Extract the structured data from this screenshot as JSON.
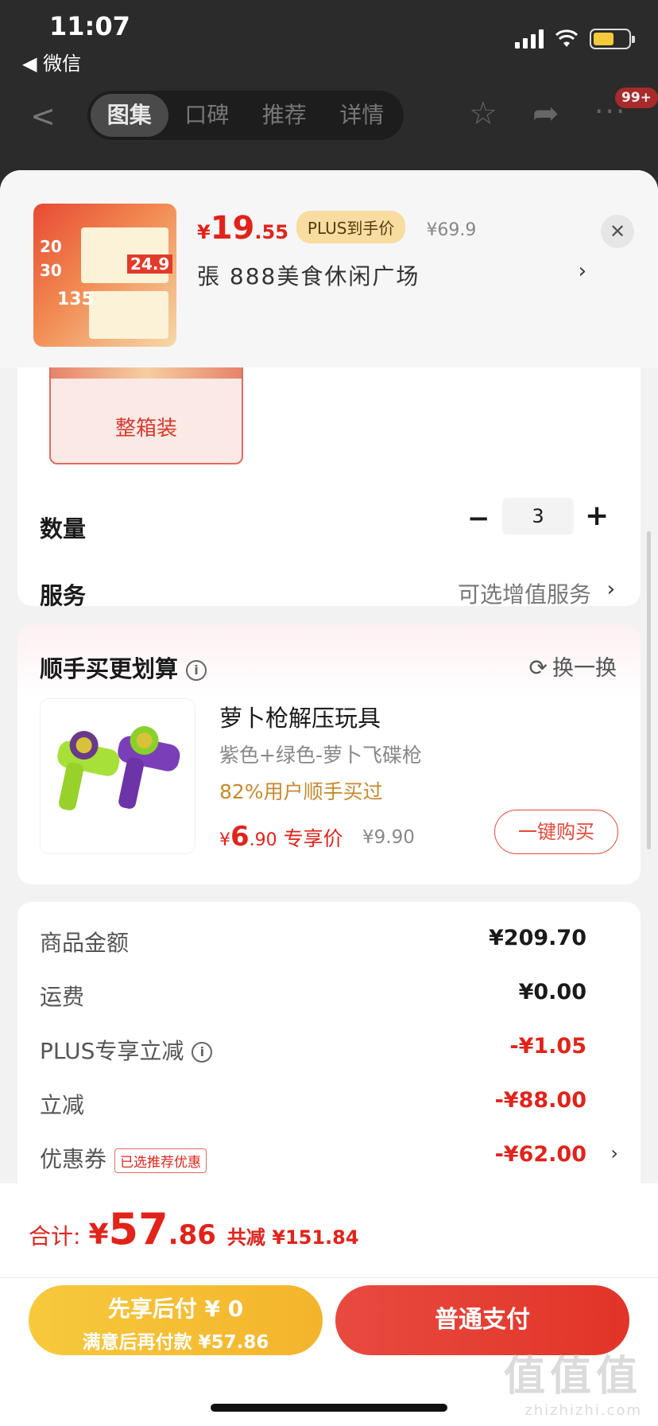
{
  "status": {
    "time": "11:07",
    "back_app": "◀ 微信"
  },
  "nav": {
    "back_icon": "chevron-left-icon",
    "tabs": [
      {
        "label": "图集",
        "active": true
      },
      {
        "label": "口碑",
        "active": false
      },
      {
        "label": "推荐",
        "active": false
      },
      {
        "label": "详情",
        "active": false
      }
    ],
    "badge": "99+"
  },
  "product": {
    "price_yen": "¥",
    "price_int": "19",
    "price_dec": ".55",
    "plus_tag": "PLUS到手价",
    "original_price": "¥69.9",
    "spec": "張  888美食休闲广场",
    "thumb_text": {
      "a": "20",
      "b": "30",
      "c": "135",
      "d": "24.9"
    }
  },
  "variant": {
    "label": "整箱装"
  },
  "quantity": {
    "label": "数量",
    "value": "3",
    "minus": "−",
    "plus": "+"
  },
  "service": {
    "label": "服务",
    "value": "可选增值服务"
  },
  "buy_together": {
    "title": "顺手买更划算",
    "refresh": "换一换",
    "name": "萝卜枪解压玩具",
    "spec": "紫色+绿色-萝卜飞碟枪",
    "hint": "82%用户顺手买过",
    "price_yen": "¥",
    "price_int": "6",
    "price_dec": ".90",
    "price_label": "专享价",
    "original_price": "¥9.90",
    "buy_label": "一键购买"
  },
  "amounts": {
    "rows": [
      {
        "label": "商品金额",
        "value": "¥209.70"
      },
      {
        "label": "运费",
        "value": "¥0.00"
      },
      {
        "label": "PLUS专享立减",
        "value": "-¥1.05"
      },
      {
        "label": "立减",
        "value": "-¥88.00"
      },
      {
        "label": "优惠券",
        "value": "-¥62.00",
        "tag": "已选推荐优惠"
      }
    ]
  },
  "total": {
    "label": "合计:",
    "yen": "¥",
    "int": "57",
    "dec": ".86",
    "saved": "共减 ¥151.84"
  },
  "buttons": {
    "later_line1": "先享后付 ¥ 0",
    "later_line2": "满意后再付款 ¥57.86",
    "pay": "普通支付"
  },
  "watermark": {
    "line1": "值值值",
    "line2": "zhizhizhi.com"
  },
  "colors": {
    "accent": "#e2231a",
    "gold": "#f7c93c",
    "hint": "#c8892d"
  }
}
